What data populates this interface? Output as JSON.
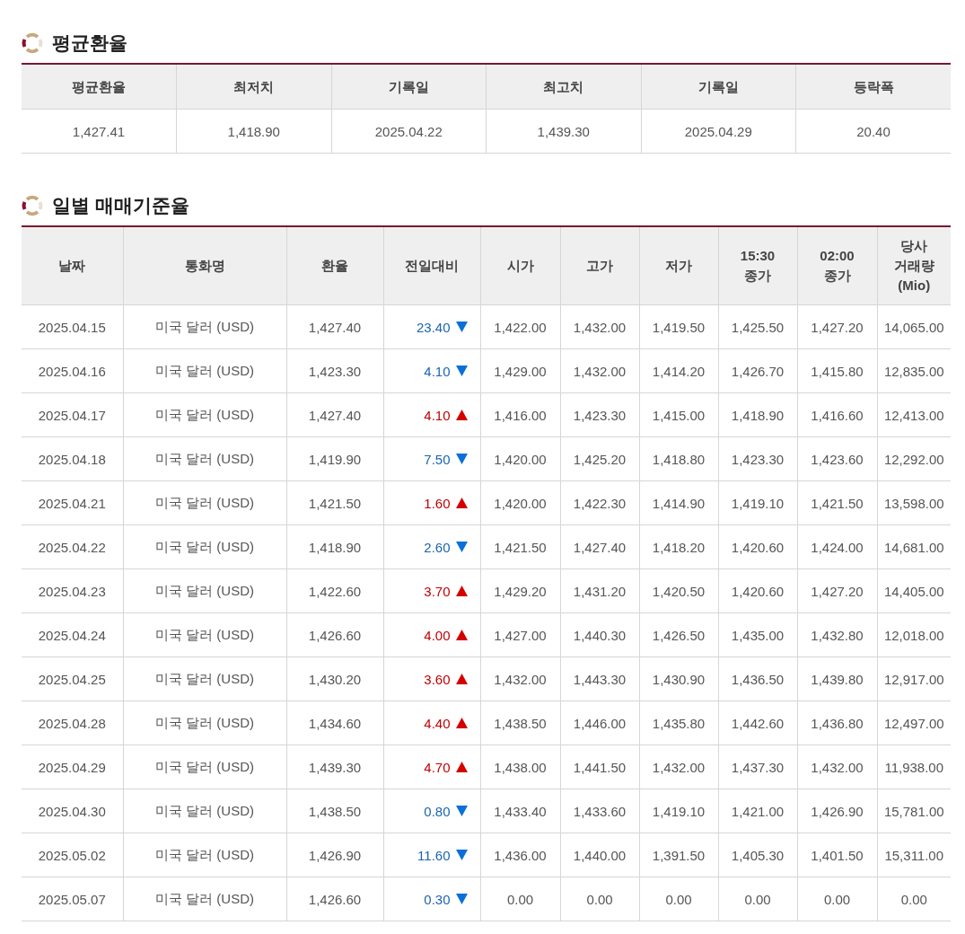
{
  "summary": {
    "title": "평균환율",
    "columns": [
      "평균환율",
      "최저치",
      "기록일",
      "최고치",
      "기록일",
      "등락폭"
    ],
    "values": [
      "1,427.41",
      "1,418.90",
      "2025.04.22",
      "1,439.30",
      "2025.04.29",
      "20.40"
    ]
  },
  "daily": {
    "title": "일별 매매기준율",
    "columns": [
      [
        "날짜"
      ],
      [
        "통화명"
      ],
      [
        "환율"
      ],
      [
        "전일대비"
      ],
      [
        "시가"
      ],
      [
        "고가"
      ],
      [
        "저가"
      ],
      [
        "15:30",
        "종가"
      ],
      [
        "02:00",
        "종가"
      ],
      [
        "당사",
        "거래량",
        "(Mio)"
      ]
    ],
    "rows": [
      {
        "date": "2025.04.15",
        "currency": "미국 달러 (USD)",
        "rate": "1,427.40",
        "change": "23.40",
        "kind": "down",
        "open": "1,422.00",
        "high": "1,432.00",
        "low": "1,419.50",
        "close1530": "1,425.50",
        "close0200": "1,427.20",
        "volume": "14,065.00"
      },
      {
        "date": "2025.04.16",
        "currency": "미국 달러 (USD)",
        "rate": "1,423.30",
        "change": "4.10",
        "kind": "down",
        "open": "1,429.00",
        "high": "1,432.00",
        "low": "1,414.20",
        "close1530": "1,426.70",
        "close0200": "1,415.80",
        "volume": "12,835.00"
      },
      {
        "date": "2025.04.17",
        "currency": "미국 달러 (USD)",
        "rate": "1,427.40",
        "change": "4.10",
        "kind": "up",
        "open": "1,416.00",
        "high": "1,423.30",
        "low": "1,415.00",
        "close1530": "1,418.90",
        "close0200": "1,416.60",
        "volume": "12,413.00"
      },
      {
        "date": "2025.04.18",
        "currency": "미국 달러 (USD)",
        "rate": "1,419.90",
        "change": "7.50",
        "kind": "down",
        "open": "1,420.00",
        "high": "1,425.20",
        "low": "1,418.80",
        "close1530": "1,423.30",
        "close0200": "1,423.60",
        "volume": "12,292.00"
      },
      {
        "date": "2025.04.21",
        "currency": "미국 달러 (USD)",
        "rate": "1,421.50",
        "change": "1.60",
        "kind": "up",
        "open": "1,420.00",
        "high": "1,422.30",
        "low": "1,414.90",
        "close1530": "1,419.10",
        "close0200": "1,421.50",
        "volume": "13,598.00"
      },
      {
        "date": "2025.04.22",
        "currency": "미국 달러 (USD)",
        "rate": "1,418.90",
        "change": "2.60",
        "kind": "down",
        "open": "1,421.50",
        "high": "1,427.40",
        "low": "1,418.20",
        "close1530": "1,420.60",
        "close0200": "1,424.00",
        "volume": "14,681.00"
      },
      {
        "date": "2025.04.23",
        "currency": "미국 달러 (USD)",
        "rate": "1,422.60",
        "change": "3.70",
        "kind": "up",
        "open": "1,429.20",
        "high": "1,431.20",
        "low": "1,420.50",
        "close1530": "1,420.60",
        "close0200": "1,427.20",
        "volume": "14,405.00"
      },
      {
        "date": "2025.04.24",
        "currency": "미국 달러 (USD)",
        "rate": "1,426.60",
        "change": "4.00",
        "kind": "up",
        "open": "1,427.00",
        "high": "1,440.30",
        "low": "1,426.50",
        "close1530": "1,435.00",
        "close0200": "1,432.80",
        "volume": "12,018.00"
      },
      {
        "date": "2025.04.25",
        "currency": "미국 달러 (USD)",
        "rate": "1,430.20",
        "change": "3.60",
        "kind": "up",
        "open": "1,432.00",
        "high": "1,443.30",
        "low": "1,430.90",
        "close1530": "1,436.50",
        "close0200": "1,439.80",
        "volume": "12,917.00"
      },
      {
        "date": "2025.04.28",
        "currency": "미국 달러 (USD)",
        "rate": "1,434.60",
        "change": "4.40",
        "kind": "up",
        "open": "1,438.50",
        "high": "1,446.00",
        "low": "1,435.80",
        "close1530": "1,442.60",
        "close0200": "1,436.80",
        "volume": "12,497.00"
      },
      {
        "date": "2025.04.29",
        "currency": "미국 달러 (USD)",
        "rate": "1,439.30",
        "change": "4.70",
        "kind": "up",
        "open": "1,438.00",
        "high": "1,441.50",
        "low": "1,432.00",
        "close1530": "1,437.30",
        "close0200": "1,432.00",
        "volume": "11,938.00"
      },
      {
        "date": "2025.04.30",
        "currency": "미국 달러 (USD)",
        "rate": "1,438.50",
        "change": "0.80",
        "kind": "down",
        "open": "1,433.40",
        "high": "1,433.60",
        "low": "1,419.10",
        "close1530": "1,421.00",
        "close0200": "1,426.90",
        "volume": "15,781.00"
      },
      {
        "date": "2025.05.02",
        "currency": "미국 달러 (USD)",
        "rate": "1,426.90",
        "change": "11.60",
        "kind": "down",
        "open": "1,436.00",
        "high": "1,440.00",
        "low": "1,391.50",
        "close1530": "1,405.30",
        "close0200": "1,401.50",
        "volume": "15,311.00"
      },
      {
        "date": "2025.05.07",
        "currency": "미국 달러 (USD)",
        "rate": "1,426.60",
        "change": "0.30",
        "kind": "down",
        "open": "0.00",
        "high": "0.00",
        "low": "0.00",
        "close1530": "0.00",
        "close0200": "0.00",
        "volume": "0.00"
      }
    ]
  }
}
